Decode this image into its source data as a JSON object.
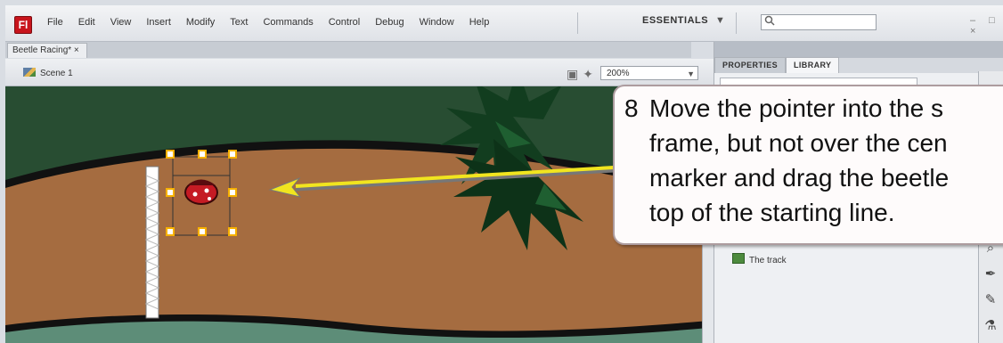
{
  "menubar": {
    "app_icon_letter": "Fl",
    "items": [
      "File",
      "Edit",
      "View",
      "Insert",
      "Modify",
      "Text",
      "Commands",
      "Control",
      "Debug",
      "Window",
      "Help"
    ],
    "workspace": "ESSENTIALS",
    "workspace_arrow": "▼",
    "search_icon": "search-icon",
    "window_controls": "– □ ×"
  },
  "document": {
    "tab_label": "Beetle Racing* ×",
    "scene_label": "Scene 1",
    "zoom_value": "200%",
    "zoom_arrow": "▼"
  },
  "panel": {
    "tabs": [
      "PROPERTIES",
      "LIBRARY"
    ],
    "library_item": "The track"
  },
  "callout": {
    "number": "8",
    "lines": [
      "Move the pointer into the s",
      "frame, but not over the cen",
      "marker and drag the beetle",
      "top of the starting line."
    ]
  },
  "colors": {
    "stage_green": "#284d32",
    "track_brown": "#a56c40",
    "track_outline": "#111111",
    "inner_green": "#5d8d78",
    "arrow_yellow": "#f1e51f",
    "selection_handle": "#f6b100"
  }
}
